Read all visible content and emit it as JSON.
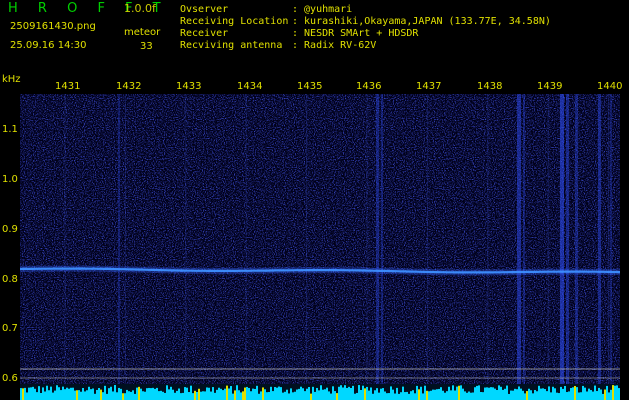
{
  "header": {
    "title": "H R O F F T",
    "version": "1.0.0f",
    "filename": "2509161430.png",
    "timestamp": "25.09.16 14:30",
    "event_label": "meteor",
    "event_count": "33"
  },
  "info": [
    {
      "label": "Ovserver",
      "value": ": @yuhmari"
    },
    {
      "label": "Receiving Location",
      "value": ": kurashiki,Okayama,JAPAN (133.77E, 34.58N)"
    },
    {
      "label": "Receiver",
      "value": ": NESDR SMArt + HDSDR"
    },
    {
      "label": "Recviving antenna",
      "value": ": Radix RV-62V"
    }
  ],
  "axis": {
    "unit": "kHz",
    "freq_ticks": [
      "1.1",
      "1.0",
      "0.9",
      "0.8",
      "0.7",
      "0.6"
    ],
    "time_ticks": [
      "1431",
      "1432",
      "1433",
      "1434",
      "1435",
      "1436",
      "1437",
      "1438",
      "1439",
      "1440"
    ]
  },
  "colors": {
    "background": "#000000",
    "signal": "#40a0ff",
    "noise": "#1020a0",
    "marker": "#e0e000",
    "level_bar": "#00e0ff"
  }
}
